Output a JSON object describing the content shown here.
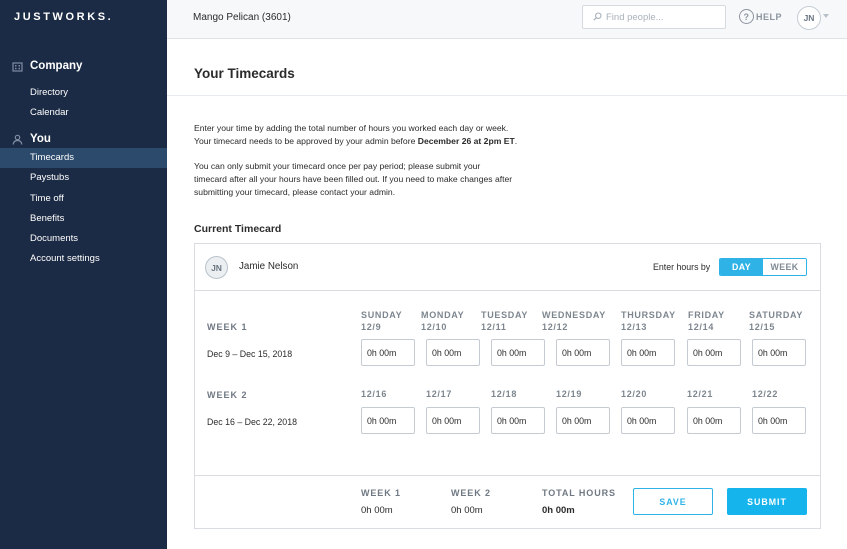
{
  "brand": {
    "logo_text": "JUSTWORKS."
  },
  "sidebar": {
    "sections": [
      {
        "title": "Company",
        "icon": "building-icon",
        "items": [
          {
            "label": "Directory"
          },
          {
            "label": "Calendar"
          }
        ]
      },
      {
        "title": "You",
        "icon": "person-icon",
        "items": [
          {
            "label": "Timecards",
            "active": true
          },
          {
            "label": "Paystubs"
          },
          {
            "label": "Time off"
          },
          {
            "label": "Benefits"
          },
          {
            "label": "Documents"
          },
          {
            "label": "Account settings"
          }
        ]
      }
    ]
  },
  "topbar": {
    "account_name": "Mango Pelican (3601)",
    "search_placeholder": "Find people...",
    "help_label": "HELP",
    "user_initials": "JN"
  },
  "page": {
    "title": "Your Timecards",
    "intro_line1": "Enter your time by adding the total number of hours you worked each day or week.",
    "intro_line2_pre": "Your timecard needs to be approved by your admin before ",
    "intro_line2_bold": "December 26 at 2pm ET",
    "intro_line2_post": ".",
    "intro_p2_line1": "You can only submit your timecard once per pay period; please submit your",
    "intro_p2_line2": "timecard after all your hours have been filled out. If you need to make changes after",
    "intro_p2_line3": "submitting your timecard, please contact your admin.",
    "section_title": "Current Timecard"
  },
  "timecard": {
    "employee_initials": "JN",
    "employee_name": "Jamie Nelson",
    "enter_hours_label": "Enter hours by",
    "mode_options": [
      "DAY",
      "WEEK"
    ],
    "mode_selected": "DAY",
    "weeks": [
      {
        "label": "WEEK 1",
        "range": "Dec 9 – Dec 15, 2018",
        "days": [
          {
            "name": "SUNDAY",
            "date": "12/9",
            "value": "0h 00m"
          },
          {
            "name": "MONDAY",
            "date": "12/10",
            "value": "0h 00m"
          },
          {
            "name": "TUESDAY",
            "date": "12/11",
            "value": "0h 00m"
          },
          {
            "name": "WEDNESDAY",
            "date": "12/12",
            "value": "0h 00m"
          },
          {
            "name": "THURSDAY",
            "date": "12/13",
            "value": "0h 00m"
          },
          {
            "name": "FRIDAY",
            "date": "12/14",
            "value": "0h 00m"
          },
          {
            "name": "SATURDAY",
            "date": "12/15",
            "value": "0h 00m"
          }
        ]
      },
      {
        "label": "WEEK 2",
        "range": "Dec 16 – Dec 22, 2018",
        "days": [
          {
            "date": "12/16",
            "value": "0h 00m"
          },
          {
            "date": "12/17",
            "value": "0h 00m"
          },
          {
            "date": "12/18",
            "value": "0h 00m"
          },
          {
            "date": "12/19",
            "value": "0h 00m"
          },
          {
            "date": "12/20",
            "value": "0h 00m"
          },
          {
            "date": "12/21",
            "value": "0h 00m"
          },
          {
            "date": "12/22",
            "value": "0h 00m"
          }
        ]
      }
    ],
    "totals": [
      {
        "label": "WEEK 1",
        "value": "0h 00m"
      },
      {
        "label": "WEEK 2",
        "value": "0h 00m"
      },
      {
        "label": "TOTAL HOURS",
        "value": "0h 00m"
      }
    ],
    "save_label": "SAVE",
    "submit_label": "SUBMIT"
  },
  "colors": {
    "sidebar_bg": "#1c2b45",
    "active_item_bg": "#2b4a6c",
    "accent": "#16b4ec"
  }
}
